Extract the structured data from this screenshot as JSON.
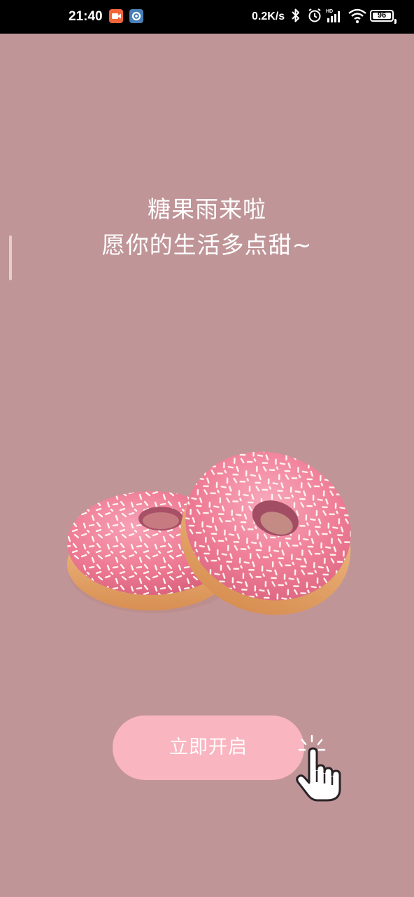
{
  "status_bar": {
    "time": "21:40",
    "network_speed": "0.2K/s",
    "battery_level": "96",
    "icons": [
      "screen-recorder-icon",
      "app-notification-icon",
      "bluetooth-icon",
      "alarm-icon",
      "hd-signal-icon",
      "wifi-icon",
      "battery-icon"
    ]
  },
  "headline": {
    "line1": "糖果雨来啦",
    "line2": "愿你的生活多点甜~"
  },
  "illustration": {
    "name": "pink-donuts"
  },
  "start_button": {
    "label": "立即开启"
  },
  "colors": {
    "background": "#c09598",
    "button": "#f9b5c0",
    "icing": "#f07b95",
    "dough": "#e8a76a"
  }
}
